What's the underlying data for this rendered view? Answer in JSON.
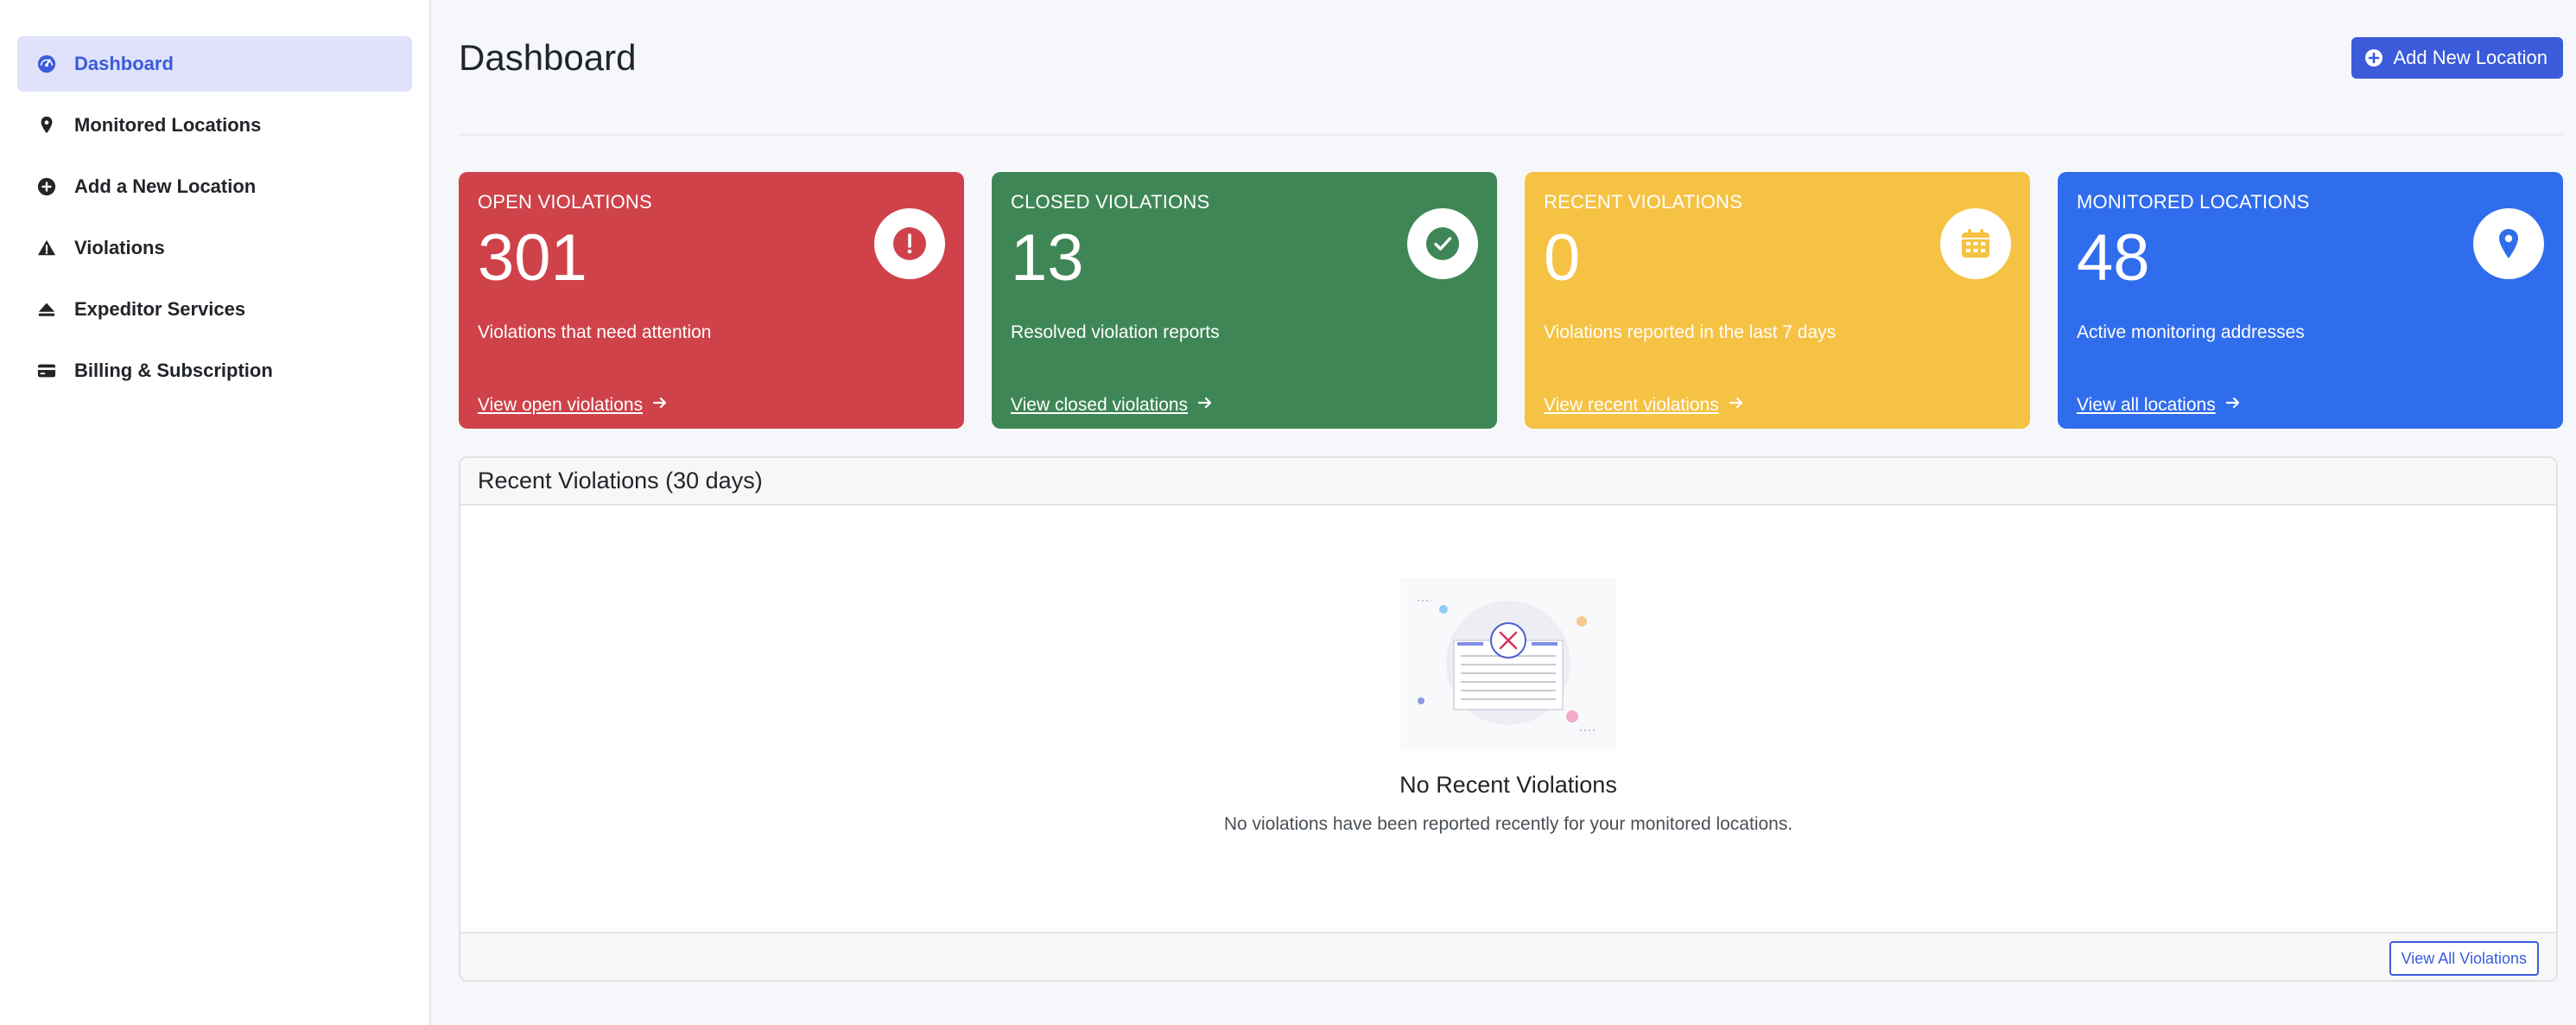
{
  "sidebar": {
    "items": [
      {
        "label": "Dashboard",
        "icon": "gauge-icon",
        "active": true
      },
      {
        "label": "Monitored Locations",
        "icon": "map-pin-icon"
      },
      {
        "label": "Add a New Location",
        "icon": "plus-circle-icon"
      },
      {
        "label": "Violations",
        "icon": "warning-triangle-icon"
      },
      {
        "label": "Expeditor Services",
        "icon": "eject-icon"
      },
      {
        "label": "Billing & Subscription",
        "icon": "credit-card-icon"
      }
    ]
  },
  "header": {
    "title": "Dashboard",
    "add_button_label": "Add New Location"
  },
  "cards": [
    {
      "title": "OPEN VIOLATIONS",
      "value": "301",
      "description": "Violations that need attention",
      "link": "View open violations",
      "color": "#cf424a",
      "icon": "exclamation-circle-icon"
    },
    {
      "title": "CLOSED VIOLATIONS",
      "value": "13",
      "description": "Resolved violation reports",
      "link": "View closed violations",
      "color": "#3f8656",
      "icon": "check-circle-icon"
    },
    {
      "title": "RECENT VIOLATIONS",
      "value": "0",
      "description": "Violations reported in the last 7 days",
      "link": "View recent violations",
      "color": "#f5c243",
      "icon": "calendar-icon"
    },
    {
      "title": "MONITORED LOCATIONS",
      "value": "48",
      "description": "Active monitoring addresses",
      "link": "View all locations",
      "color": "#306ded",
      "icon": "location-pin-icon"
    }
  ],
  "recent_panel": {
    "title": "Recent Violations (30 days)",
    "empty_title": "No Recent Violations",
    "empty_description": "No violations have been reported recently for your monitored locations.",
    "view_all_label": "View All Violations"
  },
  "colors": {
    "accent": "#3b5bdb",
    "active_nav_bg": "#dfe2fa"
  }
}
